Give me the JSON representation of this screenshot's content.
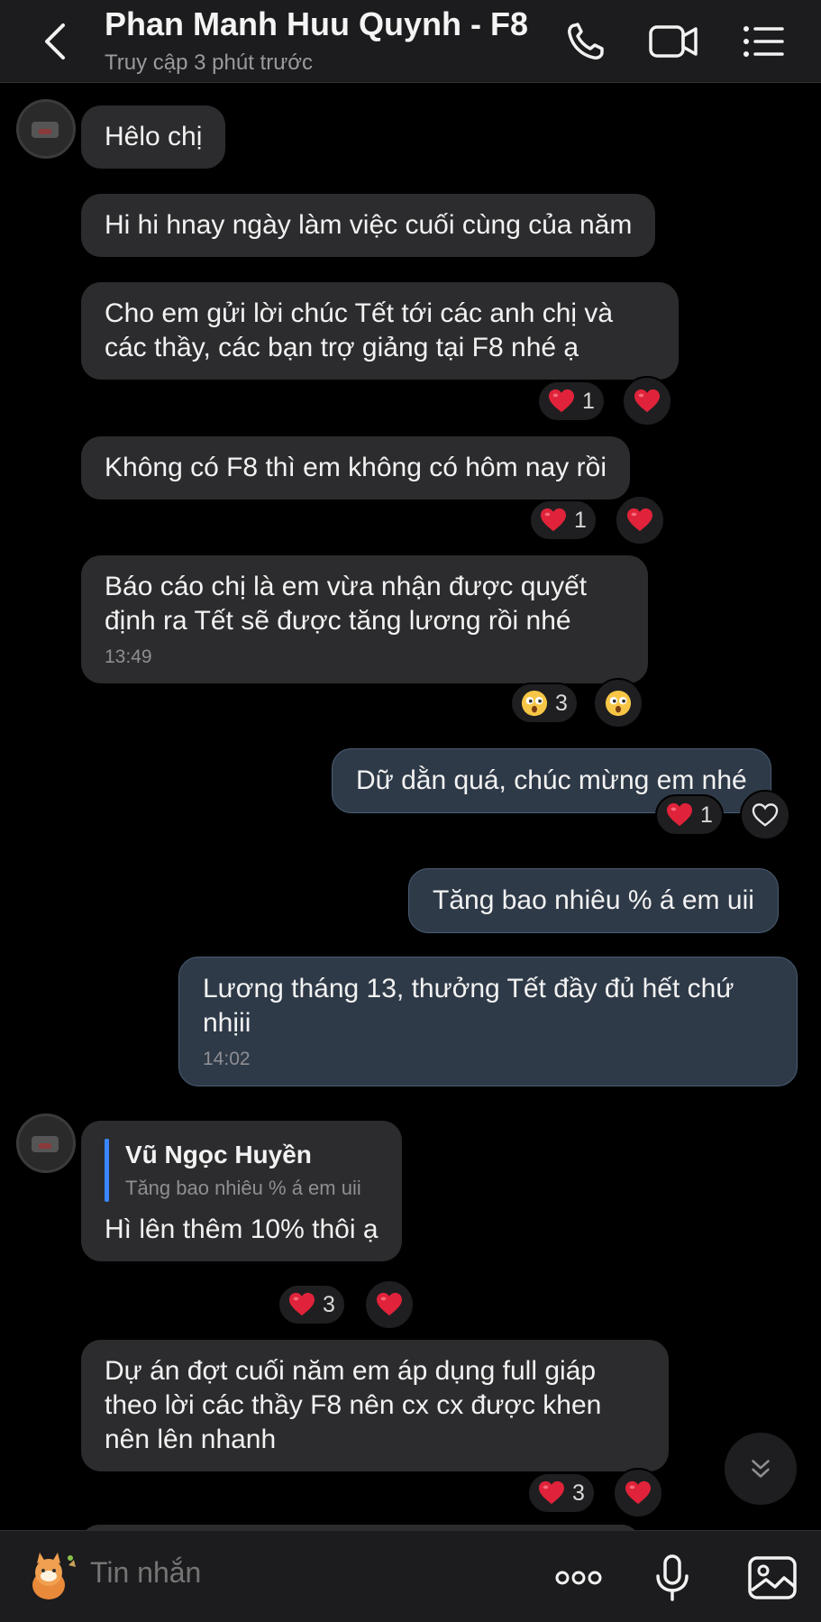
{
  "header": {
    "title": "Phan Manh Huu Quynh - F8",
    "subtitle": "Truy cập 3 phút trước"
  },
  "messages": [
    {
      "text": "Hêlo chị"
    },
    {
      "text": "Hi hi hnay ngày làm việc cuối cùng của năm"
    },
    {
      "text": "Cho em gửi lời chúc Tết tới các anh chị và các thầy, các bạn trợ giảng tại F8 nhé ạ",
      "reaction_count": "1"
    },
    {
      "text": "Không có F8 thì em không có hôm nay rồi",
      "reaction_count": "1"
    },
    {
      "text": "Báo cáo chị là em vừa nhận được quyết định ra Tết sẽ được tăng lương rồi nhé",
      "time": "13:49",
      "reaction_count": "3"
    },
    {
      "text": "Dữ dằn quá, chúc mừng em nhé",
      "reaction_count": "1"
    },
    {
      "text": "Tăng bao nhiêu % á em uii"
    },
    {
      "text": "Lương tháng 13, thưởng Tết đầy đủ hết chứ nhịii",
      "time": "14:02"
    },
    {
      "quote_name": "Vũ Ngọc Huyền",
      "quote_text": "Tăng bao nhiêu % á em uii",
      "text": "Hì lên thêm 10% thôi ạ",
      "reaction_count": "3"
    },
    {
      "text": "Dự án đợt cuối năm em áp dụng full giáp theo lời các thầy F8 nên cx cx được khen nên lên nhanh",
      "reaction_count": "3"
    }
  ],
  "composer": {
    "placeholder": "Tin nhắn"
  },
  "colors": {
    "heart": "#e0233a",
    "incoming_bubble": "#2c2c2e",
    "outgoing_bubble": "#2f3a48",
    "accent_quote": "#3a86ff"
  }
}
